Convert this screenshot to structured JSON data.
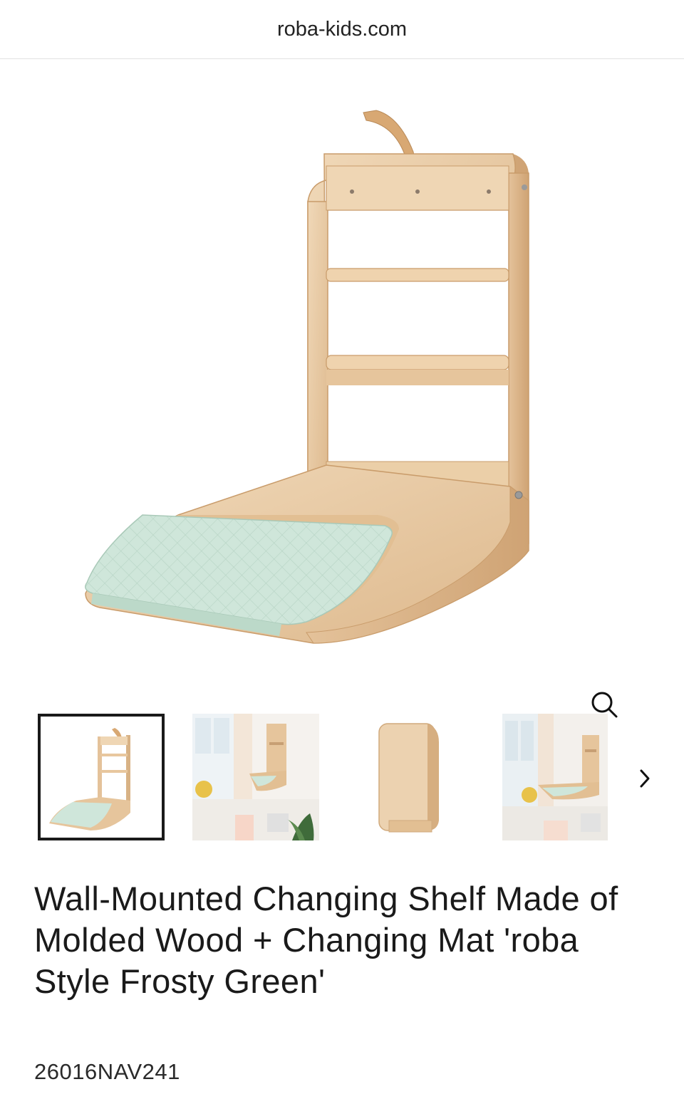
{
  "browser": {
    "url": "roba-kids.com"
  },
  "gallery": {
    "main_image_alt": "Wall-mounted changing shelf with frosty green changing mat",
    "zoom_icon": "search-icon",
    "thumbnails": [
      {
        "name": "thumbnail-product",
        "selected": true
      },
      {
        "name": "thumbnail-room-scene",
        "selected": false
      },
      {
        "name": "thumbnail-folded",
        "selected": false
      },
      {
        "name": "thumbnail-room-scene-2",
        "selected": false
      }
    ],
    "next_icon": "chevron-right-icon"
  },
  "product": {
    "title": "Wall-Mounted Changing Shelf Made of Molded Wood + Changing Mat 'roba Style Frosty Green'",
    "sku": "26016NAV241"
  },
  "colors": {
    "wood": "#e8c9a3",
    "wood_dark": "#d6ae80",
    "mat": "#cfe6da",
    "border": "#1a1a1a"
  }
}
